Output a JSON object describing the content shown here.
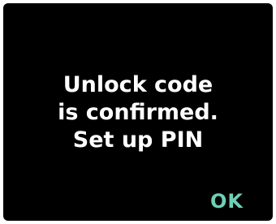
{
  "screen": {
    "message_lines": [
      "Unlock code",
      "is confirmed.",
      "Set up PIN"
    ],
    "ok_label": "OK"
  },
  "colors": {
    "background": "#000000",
    "text": "#ffffff",
    "accent": "#6fcfb6"
  }
}
